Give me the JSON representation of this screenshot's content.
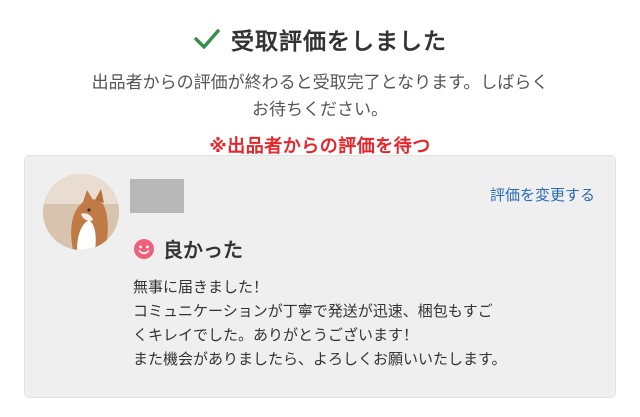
{
  "header": {
    "icon": "check-icon",
    "title": "受取評価をしました",
    "check_color": "#3a8f4f"
  },
  "description": {
    "line1": "出品者からの評価が終わると受取完了となります。しばらく",
    "line2": "お待ちください。"
  },
  "note": "※出品者からの評価を待つ",
  "review_card": {
    "avatar_icon": "cat-avatar",
    "change_link": "評価を変更する",
    "rating": {
      "icon": "smile-face-icon",
      "label": "良かった",
      "icon_color": "#f0607a"
    },
    "comment_lines": [
      "無事に届きました！",
      "コミュニケーションが丁寧で発送が迅速、梱包もすご",
      "くキレイでした。ありがとうございます！",
      "また機会がありましたら、よろしくお願いいたします。"
    ]
  }
}
